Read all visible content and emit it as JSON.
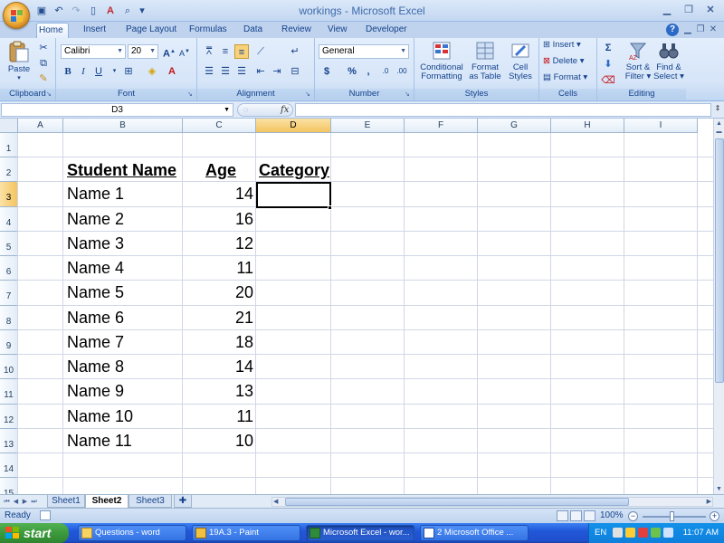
{
  "window": {
    "title": "workings - Microsoft Excel"
  },
  "tabs": [
    "Home",
    "Insert",
    "Page Layout",
    "Formulas",
    "Data",
    "Review",
    "View",
    "Developer"
  ],
  "ribbon": {
    "clipboard": {
      "label": "Clipboard",
      "paste": "Paste"
    },
    "font": {
      "label": "Font",
      "family": "Calibri",
      "size": "20",
      "bold": "B",
      "italic": "I",
      "underline": "U"
    },
    "alignment": {
      "label": "Alignment"
    },
    "number": {
      "label": "Number",
      "format": "General",
      "currency": "$",
      "percent": "%",
      "comma": ","
    },
    "styles": {
      "label": "Styles",
      "conditional_1": "Conditional",
      "conditional_2": "Formatting",
      "format_table_1": "Format",
      "format_table_2": "as Table",
      "cell_styles_1": "Cell",
      "cell_styles_2": "Styles"
    },
    "cells": {
      "label": "Cells",
      "insert": "Insert",
      "delete": "Delete",
      "format": "Format"
    },
    "editing": {
      "label": "Editing",
      "sigma": "Σ",
      "sort_1": "Sort &",
      "sort_2": "Filter",
      "find_1": "Find &",
      "find_2": "Select"
    }
  },
  "formula_bar": {
    "name_box": "D3",
    "fx": "fx",
    "value": ""
  },
  "columns": [
    "A",
    "B",
    "C",
    "D",
    "E",
    "F",
    "G",
    "H",
    "I"
  ],
  "rows": [
    "1",
    "2",
    "3",
    "4",
    "5",
    "6",
    "7",
    "8",
    "9",
    "10",
    "11",
    "12",
    "13",
    "14",
    "15"
  ],
  "sheet": {
    "headers": {
      "name": "Student Name",
      "age": "Age",
      "category": "Category"
    },
    "students": [
      {
        "name": "Name 1",
        "age": "14"
      },
      {
        "name": "Name 2",
        "age": "16"
      },
      {
        "name": "Name 3",
        "age": "12"
      },
      {
        "name": "Name 4",
        "age": "11"
      },
      {
        "name": "Name 5",
        "age": "20"
      },
      {
        "name": "Name 6",
        "age": "21"
      },
      {
        "name": "Name 7",
        "age": "18"
      },
      {
        "name": "Name 8",
        "age": "14"
      },
      {
        "name": "Name 9",
        "age": "13"
      },
      {
        "name": "Name 10",
        "age": "11"
      },
      {
        "name": "Name 11",
        "age": "10"
      }
    ],
    "selected_cell": "D3"
  },
  "sheet_tabs": [
    "Sheet1",
    "Sheet2",
    "Sheet3"
  ],
  "active_sheet": "Sheet2",
  "status": {
    "text": "Ready",
    "zoom": "100%"
  },
  "taskbar": {
    "start": "start",
    "items": [
      {
        "label": "Questions - word",
        "active": false
      },
      {
        "label": "19A.3 - Paint",
        "active": false
      },
      {
        "label": "Microsoft Excel - wor...",
        "active": true
      },
      {
        "label": "2 Microsoft Office ...",
        "active": false
      }
    ],
    "lang": "EN",
    "clock": "11:07 AM"
  },
  "colors": {
    "ribbon": "#d6e5f8",
    "selected_header": "#f4c460",
    "taskbar": "#2157d9",
    "start": "#3c9a3c"
  }
}
